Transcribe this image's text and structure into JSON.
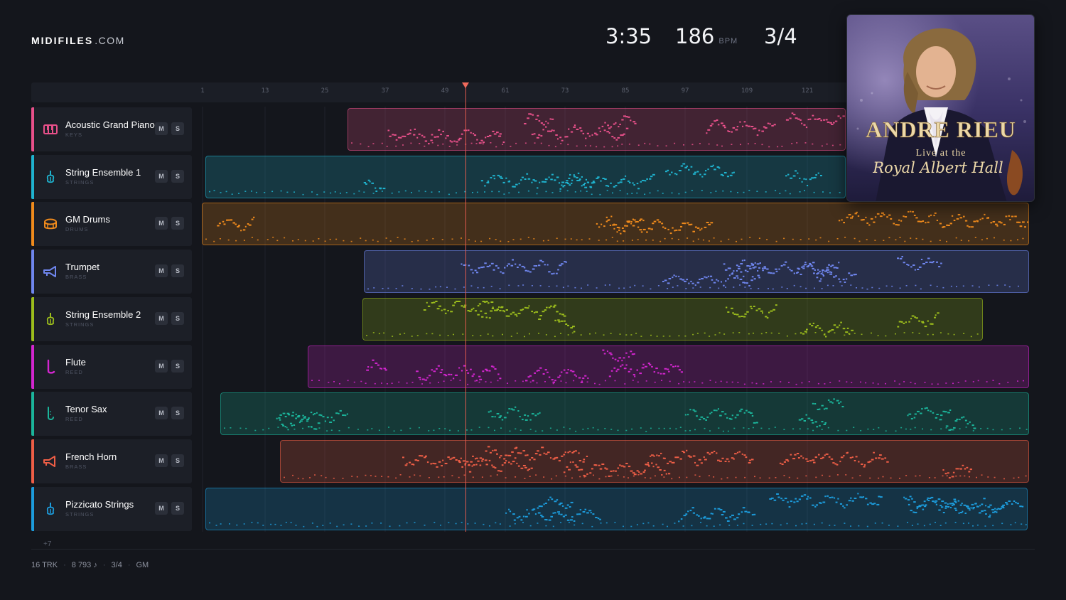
{
  "brand": {
    "name": "MIDIFILES",
    "domain": ".COM"
  },
  "stats": {
    "time": "3:35",
    "bpm": "186",
    "bpm_unit": "BPM",
    "time_signature": "3/4"
  },
  "ruler": {
    "bars": [
      "1",
      "13",
      "25",
      "37",
      "49",
      "61",
      "73",
      "85",
      "97",
      "109",
      "121"
    ]
  },
  "playhead": {
    "bar": 50
  },
  "buttons": {
    "mute": "M",
    "solo": "S"
  },
  "tracks": [
    {
      "name": "Acoustic Grand Piano",
      "category": "KEYS",
      "color": "#e8508a",
      "icon": "piano-icon"
    },
    {
      "name": "String Ensemble 1",
      "category": "STRINGS",
      "color": "#1fb3cf",
      "icon": "violin-icon"
    },
    {
      "name": "GM Drums",
      "category": "DRUMS",
      "color": "#ef8a1c",
      "icon": "drum-icon"
    },
    {
      "name": "Trumpet",
      "category": "BRASS",
      "color": "#6f86ee",
      "icon": "trumpet-icon"
    },
    {
      "name": "String Ensemble 2",
      "category": "STRINGS",
      "color": "#9cbd1c",
      "icon": "violin-icon"
    },
    {
      "name": "Flute",
      "category": "REED",
      "color": "#d326cf",
      "icon": "flute-icon"
    },
    {
      "name": "Tenor Sax",
      "category": "REED",
      "color": "#1bb59b",
      "icon": "sax-icon"
    },
    {
      "name": "French Horn",
      "category": "BRASS",
      "color": "#ee5e46",
      "icon": "horn-icon"
    },
    {
      "name": "Pizzicato Strings",
      "category": "STRINGS",
      "color": "#1c9cdc",
      "icon": "violin-icon"
    }
  ],
  "more_tracks": "+7",
  "footer": {
    "tracks": "16 TRK",
    "notes": "8 793 ♪",
    "time_signature": "3/4",
    "standard": "GM"
  },
  "album": {
    "artist": "ANDRE RIEU",
    "subtitle": "Live at the",
    "venue": "Royal Albert Hall"
  }
}
